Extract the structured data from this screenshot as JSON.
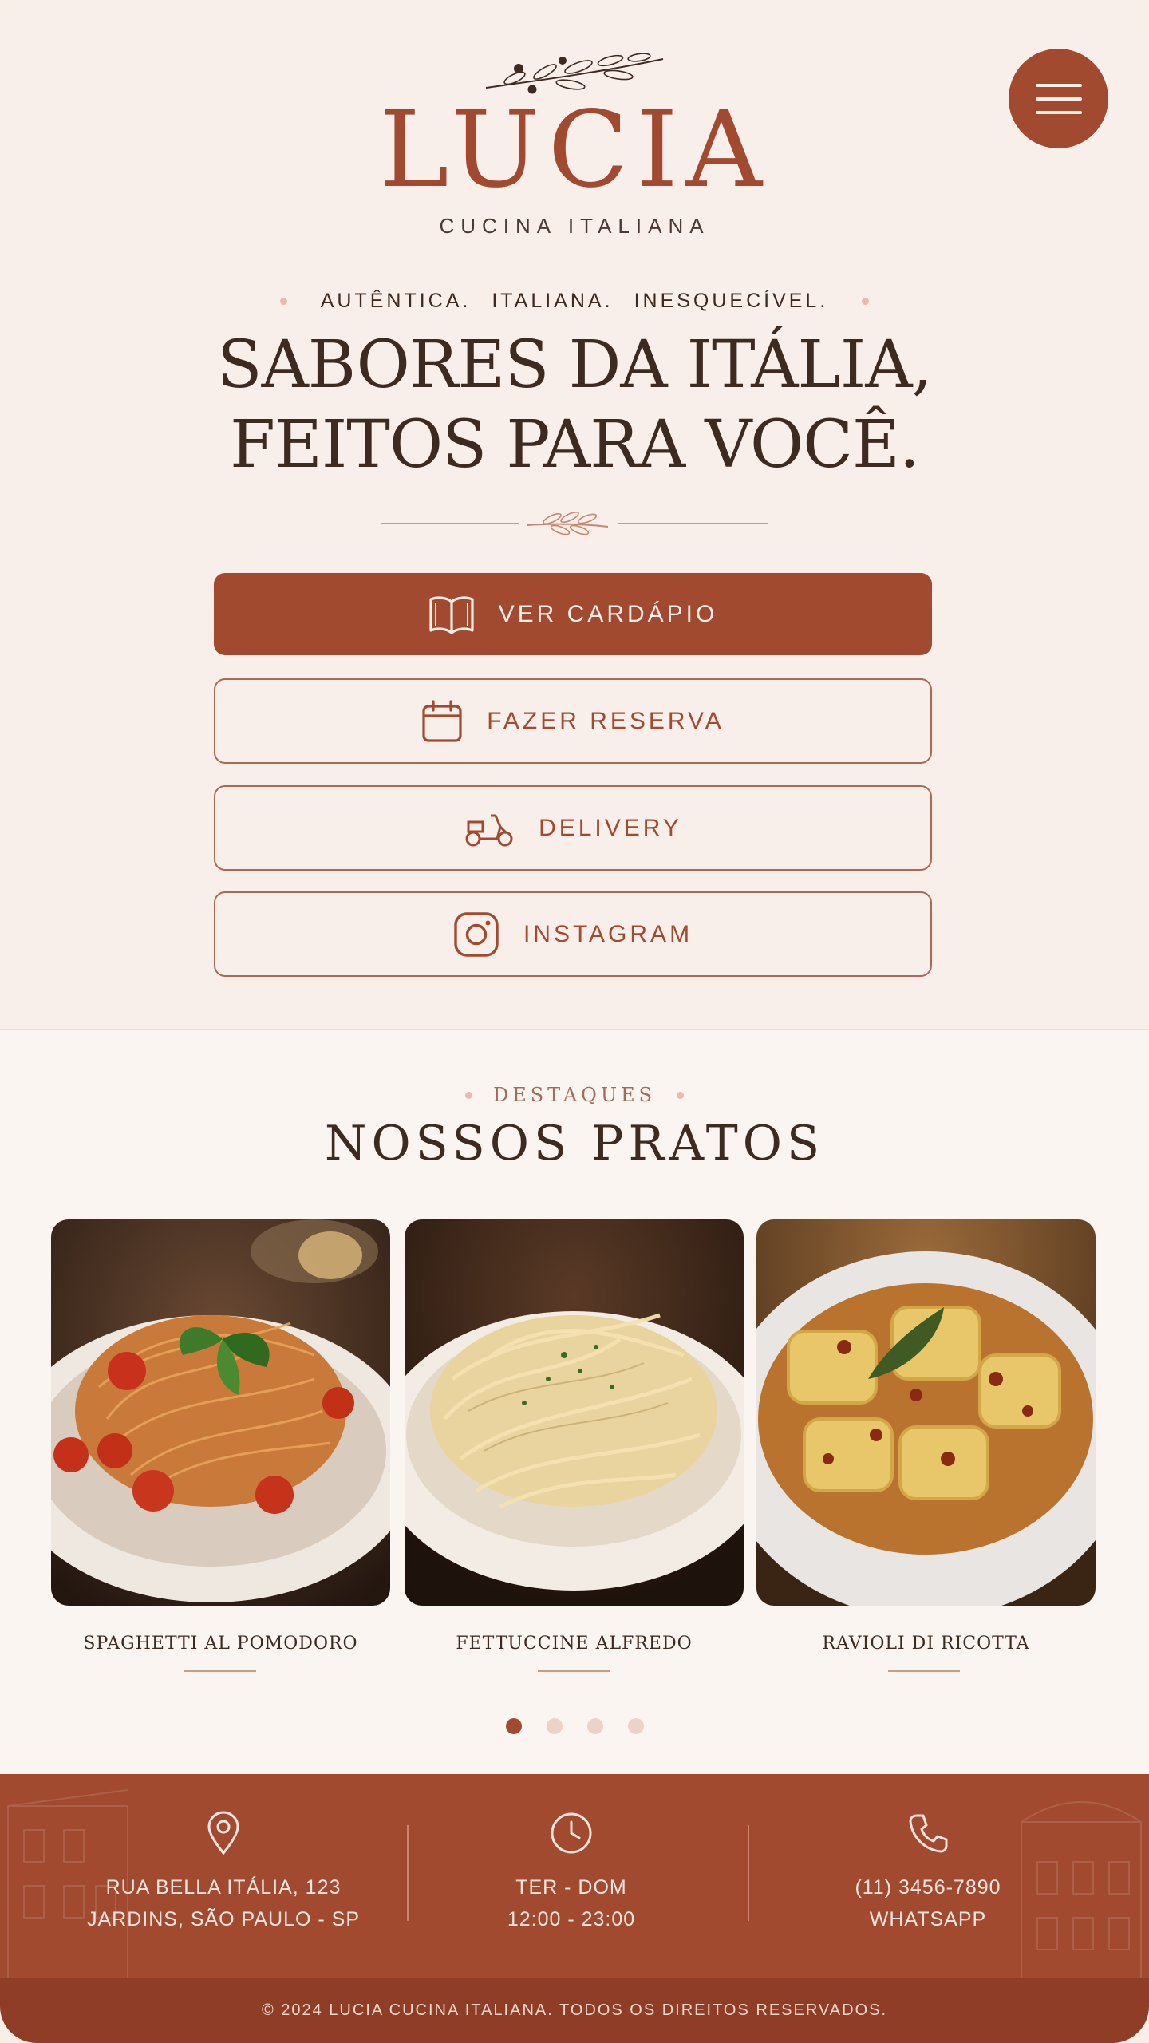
{
  "brand": {
    "name": "LUCIA",
    "subtitle": "CUCINA ITALIANA",
    "menu_icon": "hamburger-icon",
    "colors": {
      "primary": "#a24a30",
      "background": "#f8efea",
      "text": "#3d2b22"
    }
  },
  "hero": {
    "tagline": [
      "AUTÊNTICA.",
      "ITALIANA.",
      "INESQUECÍVEL."
    ],
    "headline_line1": "SABORES DA ITÁLIA,",
    "headline_line2": "FEITOS PARA VOCÊ."
  },
  "actions": {
    "menu": {
      "label": "VER CARDÁPIO",
      "icon": "book-icon"
    },
    "reserve": {
      "label": "FAZER RESERVA",
      "icon": "calendar-icon"
    },
    "delivery": {
      "label": "DELIVERY",
      "icon": "scooter-icon"
    },
    "instagram": {
      "label": "INSTAGRAM",
      "icon": "instagram-icon"
    }
  },
  "featured": {
    "kicker": "DESTAQUES",
    "title": "NOSSOS PRATOS",
    "dishes": [
      {
        "name": "SPAGHETTI AL POMODORO"
      },
      {
        "name": "FETTUCCINE ALFREDO"
      },
      {
        "name": "RAVIOLI DI RICOTTA"
      }
    ],
    "carousel": {
      "pages": 4,
      "active": 1
    }
  },
  "footer": {
    "address": {
      "icon": "location-pin-icon",
      "line1": "RUA BELLA ITÁLIA, 123",
      "line2": "JARDINS, SÃO PAULO - SP"
    },
    "hours": {
      "icon": "clock-icon",
      "line1": "TER - DOM",
      "line2": "12:00 - 23:00"
    },
    "contact": {
      "icon": "phone-icon",
      "line1": "(11) 3456-7890",
      "line2": "WHATSAPP"
    },
    "copyright": "© 2024 LUCIA CUCINA ITALIANA. TODOS OS DIREITOS RESERVADOS."
  }
}
